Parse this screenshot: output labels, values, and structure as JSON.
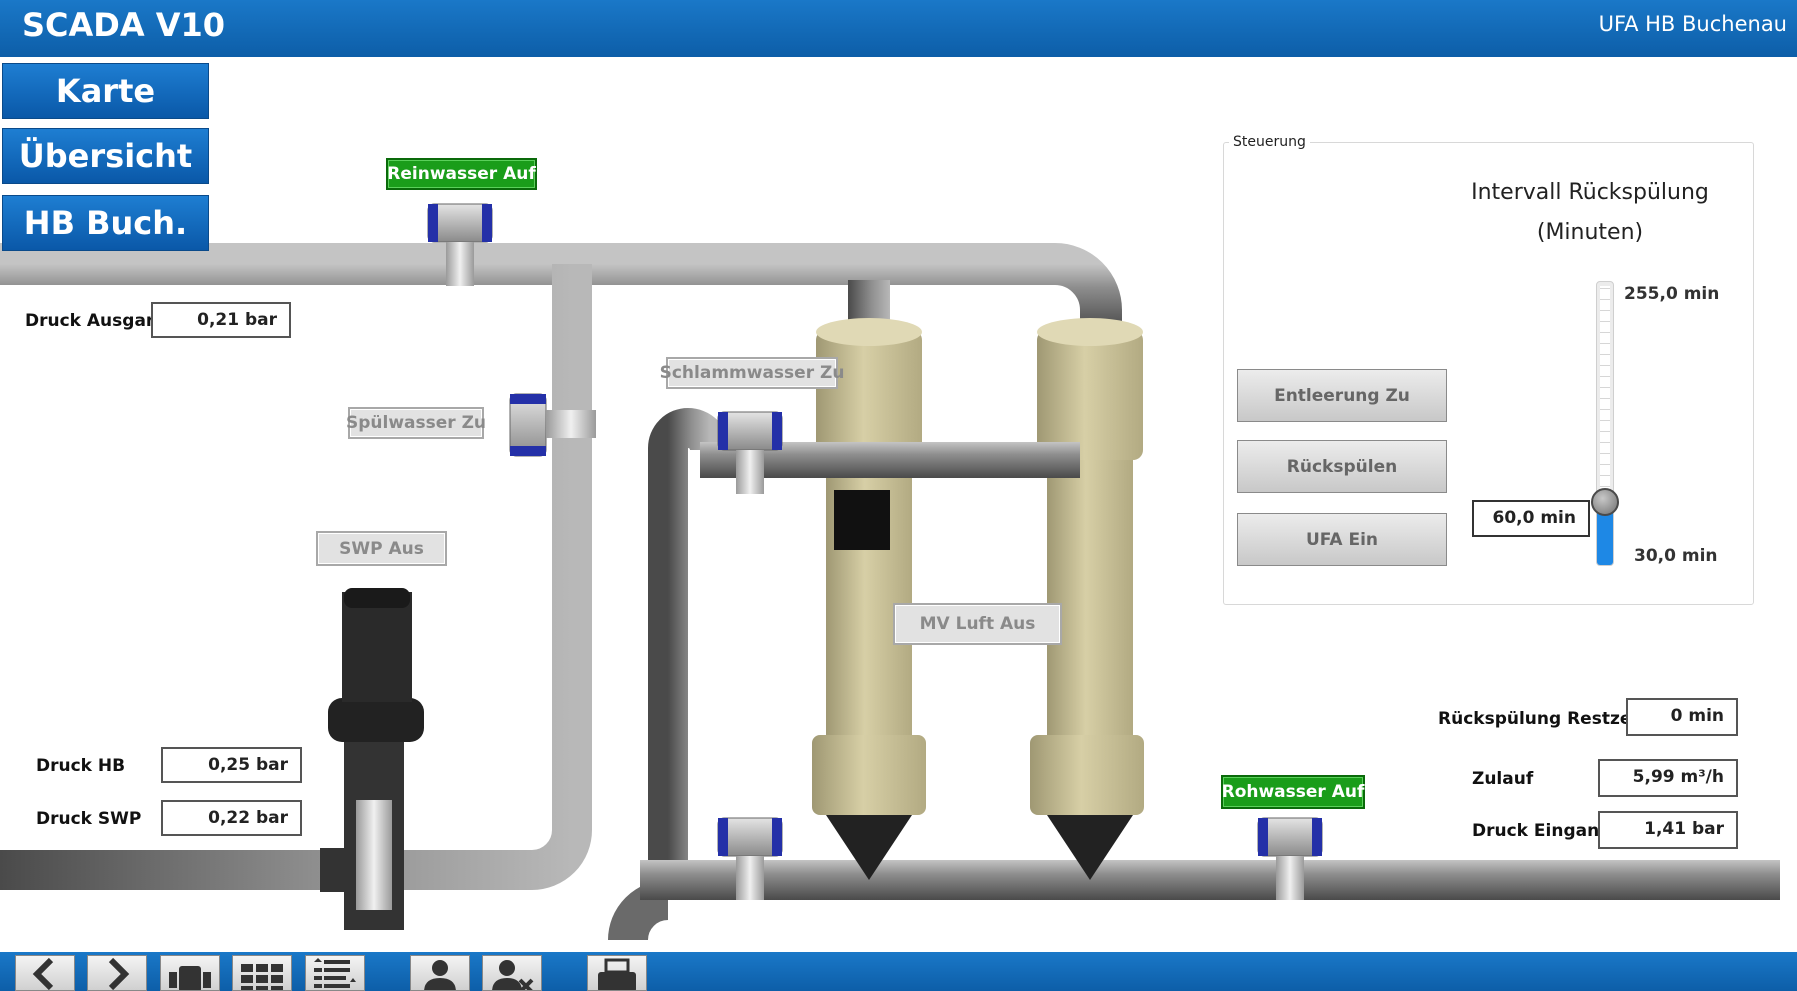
{
  "header": {
    "title": "SCADA V10",
    "site": "UFA HB Buchenau"
  },
  "nav": [
    {
      "label": "Karte"
    },
    {
      "label": "Übersicht"
    },
    {
      "label": "HB Buch."
    }
  ],
  "readings": {
    "druck_ausgang": {
      "label": "Druck Ausgang",
      "value": "0,21 bar"
    },
    "druck_hb": {
      "label": "Druck HB",
      "value": "0,25 bar"
    },
    "druck_swp": {
      "label": "Druck SWP",
      "value": "0,22 bar"
    },
    "restzeit": {
      "label": "Rückspülung Restzeit",
      "value": "0 min"
    },
    "zulauf": {
      "label": "Zulauf",
      "value": "5,99 m³/h"
    },
    "druck_eingang": {
      "label": "Druck Eingang",
      "value": "1,41 bar"
    }
  },
  "tags": {
    "reinwasser": "Reinwasser Auf",
    "spuelwasser": "Spülwasser Zu",
    "schlammwasser": "Schlammwasser Zu",
    "swp": "SWP Aus",
    "mv_luft": "MV Luft Aus",
    "rohwasser": "Rohwasser Auf"
  },
  "control": {
    "legend": "Steuerung",
    "buttons": [
      {
        "label": "Entleerung Zu"
      },
      {
        "label": "Rückspülen"
      },
      {
        "label": "UFA Ein"
      }
    ],
    "interval_title_line1": "Intervall Rückspülung",
    "interval_title_line2": "(Minuten)",
    "slider": {
      "max_label": "255,0 min",
      "min_label": "30,0 min",
      "value_label": "60,0 min",
      "min": 30,
      "max": 255,
      "value": 60
    }
  },
  "toolbar": [
    "prev-icon",
    "next-icon",
    "pump-icon",
    "grid-icon",
    "list-icon",
    "user-icon",
    "user-remove-icon",
    "print-icon"
  ],
  "colors": {
    "header": "#1470c0",
    "active_valve": "#1a9d1a",
    "pipe": "#7a7a7a",
    "vessel": "#cbc39a",
    "slider_fill": "#1e88e5"
  }
}
